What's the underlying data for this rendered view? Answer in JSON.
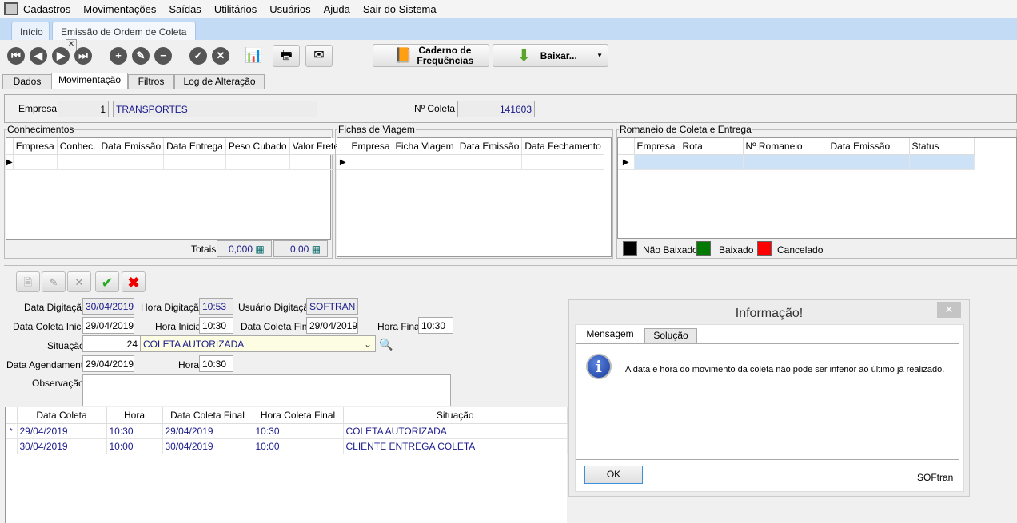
{
  "menu": [
    "Cadastros",
    "Movimentações",
    "Saídas",
    "Utilitários",
    "Usuários",
    "Ajuda",
    "Sair do Sistema"
  ],
  "doc_tabs": {
    "home": "Início",
    "current": "Emissão de Ordem de Coleta"
  },
  "toolbar": {
    "caderno": "Caderno de Frequências",
    "baixar": "Baixar...",
    "icons": [
      "first-record-icon",
      "previous-record-icon",
      "next-record-icon",
      "last-record-icon",
      "add-icon",
      "edit-icon",
      "remove-icon",
      "confirm-icon",
      "cancel-icon",
      "chart-settings-icon",
      "print-icon",
      "export-icon"
    ]
  },
  "page_tabs": [
    "Dados",
    "Movimentação",
    "Filtros",
    "Log de Alteração"
  ],
  "header": {
    "empresa_label": "Empresa",
    "empresa_code": "1",
    "empresa_name": "TRANSPORTES",
    "coleta_label": "Nº Coleta",
    "coleta_value": "141603"
  },
  "conhecimentos": {
    "title": "Conhecimentos",
    "columns": [
      "Empresa",
      "Conhec.",
      "Data Emissão",
      "Data Entrega",
      "Peso Cubado",
      "Valor Frete"
    ],
    "totais_label": "Totais",
    "total_peso": "0,000",
    "total_valor": "0,00"
  },
  "fichas": {
    "title": "Fichas de Viagem",
    "columns": [
      "Empresa",
      "Ficha Viagem",
      "Data Emissão",
      "Data Fechamento"
    ]
  },
  "romaneio": {
    "title": "Romaneio de Coleta e Entrega",
    "columns": [
      "Empresa",
      "Rota",
      "Nº Romaneio",
      "Data Emissão",
      "Status"
    ]
  },
  "legend": [
    {
      "label": "Não Baixado",
      "color": "#000000"
    },
    {
      "label": "Baixado",
      "color": "#007a00"
    },
    {
      "label": "Cancelado",
      "color": "#ff0000"
    }
  ],
  "form": {
    "data_digitacao_label": "Data Digitação",
    "data_digitacao": "30/04/2019",
    "hora_digitacao_label": "Hora Digitação",
    "hora_digitacao": "10:53",
    "usuario_label": "Usuário Digitação",
    "usuario": "SOFTRAN",
    "data_coleta_inicial_label": "Data Coleta Inicial",
    "data_coleta_inicial": "29/04/2019",
    "hora_inicial_label": "Hora Inicial",
    "hora_inicial": "10:30",
    "data_coleta_final_label": "Data Coleta Final",
    "data_coleta_final": "29/04/2019",
    "hora_final_label": "Hora Final",
    "hora_final": "10:30",
    "situacao_label": "Situação",
    "situacao_code": "24",
    "situacao": "COLETA AUTORIZADA",
    "data_agendamento_label": "Data Agendamento",
    "data_agendamento": "29/04/2019",
    "hora_label": "Hora",
    "hora": "10:30",
    "observacao_label": "Observação",
    "observacao": ""
  },
  "history": {
    "columns": [
      "Data Coleta",
      "Hora",
      "Data Coleta Final",
      "Hora Coleta Final",
      "Situação"
    ],
    "rows": [
      [
        "29/04/2019",
        "10:30",
        "29/04/2019",
        "10:30",
        "COLETA AUTORIZADA"
      ],
      [
        "30/04/2019",
        "10:00",
        "30/04/2019",
        "10:00",
        "CLIENTE ENTREGA COLETA"
      ]
    ]
  },
  "dialog": {
    "title": "Informação!",
    "tabs": [
      "Mensagem",
      "Solução"
    ],
    "message": "A data e hora do movimento da coleta não pode ser inferior ao último já realizado.",
    "ok": "OK",
    "brand": "SOFtran"
  }
}
